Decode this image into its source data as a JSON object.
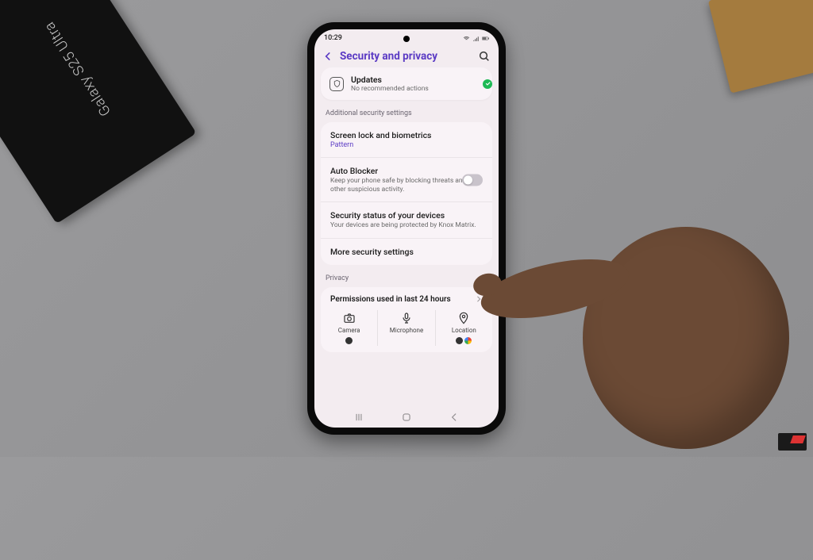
{
  "environment": {
    "box_label": "Galaxy S25 Ultra"
  },
  "statusbar": {
    "time": "10:29"
  },
  "header": {
    "title": "Security and privacy"
  },
  "updates_card": {
    "title": "Updates",
    "subtitle": "No recommended actions"
  },
  "sections": {
    "additional": "Additional security settings",
    "privacy": "Privacy"
  },
  "rows": {
    "screen_lock": {
      "title": "Screen lock and biometrics",
      "value": "Pattern"
    },
    "auto_blocker": {
      "title": "Auto Blocker",
      "subtitle": "Keep your phone safe by blocking threats and other suspicious activity."
    },
    "security_status": {
      "title": "Security status of your devices",
      "subtitle": "Your devices are being protected by Knox Matrix."
    },
    "more": {
      "title": "More security settings"
    }
  },
  "permissions": {
    "header": "Permissions used in last 24 hours",
    "cols": {
      "camera": "Camera",
      "microphone": "Microphone",
      "location": "Location"
    }
  }
}
